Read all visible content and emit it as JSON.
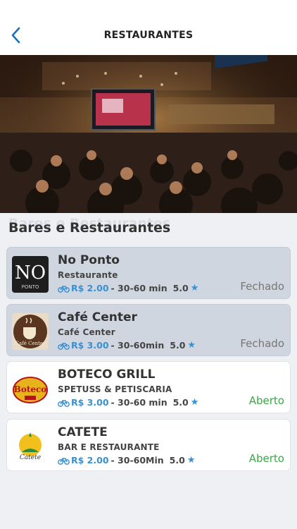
{
  "header": {
    "title": "RESTAURANTES",
    "back_icon": "chevron-left-icon",
    "accent": "#1e6fc0"
  },
  "section": {
    "heading": "Bares e Restaurantes"
  },
  "colors": {
    "price": "#3a8fd0",
    "open": "#3aa845",
    "closed": "#777777"
  },
  "restaurants": [
    {
      "name": "No Ponto",
      "subtitle": "Restaurante",
      "price": "R$ 2.00",
      "time": "- 30-60 min",
      "rating": "5.0",
      "status": "Fechado",
      "logo_icon": "no-ponto-logo",
      "logo_text": "PONTO"
    },
    {
      "name": "Café Center",
      "subtitle": "Café Center",
      "price": "R$ 3.00",
      "time": "- 30-60min",
      "rating": "5.0",
      "status": "Fechado",
      "logo_icon": "cafe-center-logo",
      "logo_text": "Café Center"
    },
    {
      "name": "BOTECO GRILL",
      "subtitle": "SPETUSS & PETISCARIA",
      "price": "R$ 3.00",
      "time": "- 30-60 min",
      "rating": "5.0",
      "status": "Aberto",
      "logo_icon": "boteco-grill-logo",
      "logo_text": "Boteco"
    },
    {
      "name": "CATETE",
      "subtitle": "BAR E RESTAURANTE",
      "price": "R$ 2.00",
      "time": "- 30-60Min",
      "rating": "5.0",
      "status": "Aberto",
      "logo_icon": "catete-logo",
      "logo_text": "Catete"
    }
  ]
}
